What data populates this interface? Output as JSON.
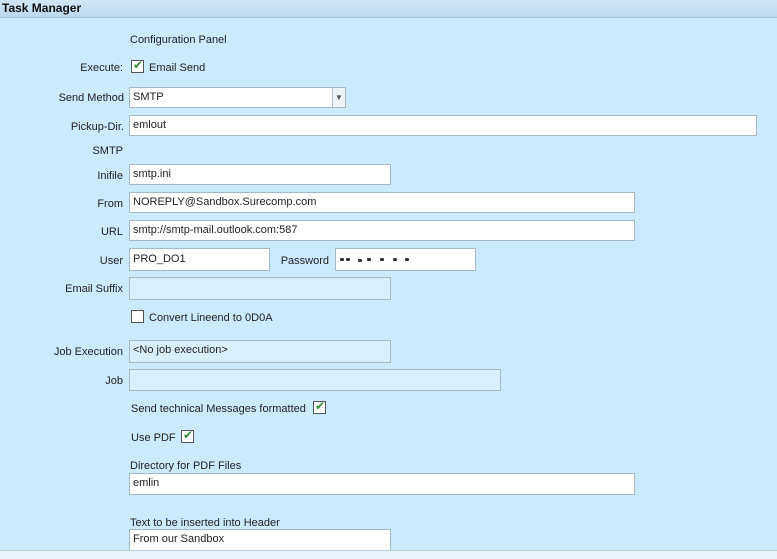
{
  "window": {
    "title": "Task Manager"
  },
  "panel": {
    "heading": "Configuration Panel"
  },
  "execute": {
    "label": "Execute:",
    "checkbox_label": "Email Send",
    "checked": true
  },
  "send_method": {
    "label": "Send Method",
    "value": "SMTP"
  },
  "pickup_dir": {
    "label": "Pickup-Dir.",
    "value": "emlout"
  },
  "smtp_section": {
    "label": "SMTP"
  },
  "inifile": {
    "label": "Inifile",
    "value": "smtp.ini"
  },
  "from": {
    "label": "From",
    "value": "NOREPLY@Sandbox.Surecomp.com"
  },
  "url": {
    "label": "URL",
    "value": "smtp://smtp-mail.outlook.com:587"
  },
  "user": {
    "label": "User",
    "value": "PRO_DO1"
  },
  "password": {
    "label": "Password"
  },
  "email_suffix": {
    "label": "Email Suffix",
    "value": ""
  },
  "convert_lineend": {
    "label": "Convert Lineend to 0D0A",
    "checked": false
  },
  "job_execution": {
    "label": "Job Execution",
    "value": "<No job execution>"
  },
  "job": {
    "label": "Job",
    "value": ""
  },
  "send_technical": {
    "label": "Send technical Messages formatted",
    "checked": true
  },
  "use_pdf": {
    "label": "Use PDF",
    "checked": true
  },
  "pdf_directory": {
    "label": "Directory for PDF Files",
    "value": "emlin"
  },
  "header_text": {
    "label": "Text to be inserted into Header",
    "value": "From our Sandbox"
  },
  "colors": {
    "background": "#cbeafd",
    "check": "#2f8f2f",
    "titlebar": "#bcd9ef"
  },
  "icons": {
    "checkbox_mark": "checkmark-icon",
    "dropdown": "dropdown-arrow-icon"
  }
}
